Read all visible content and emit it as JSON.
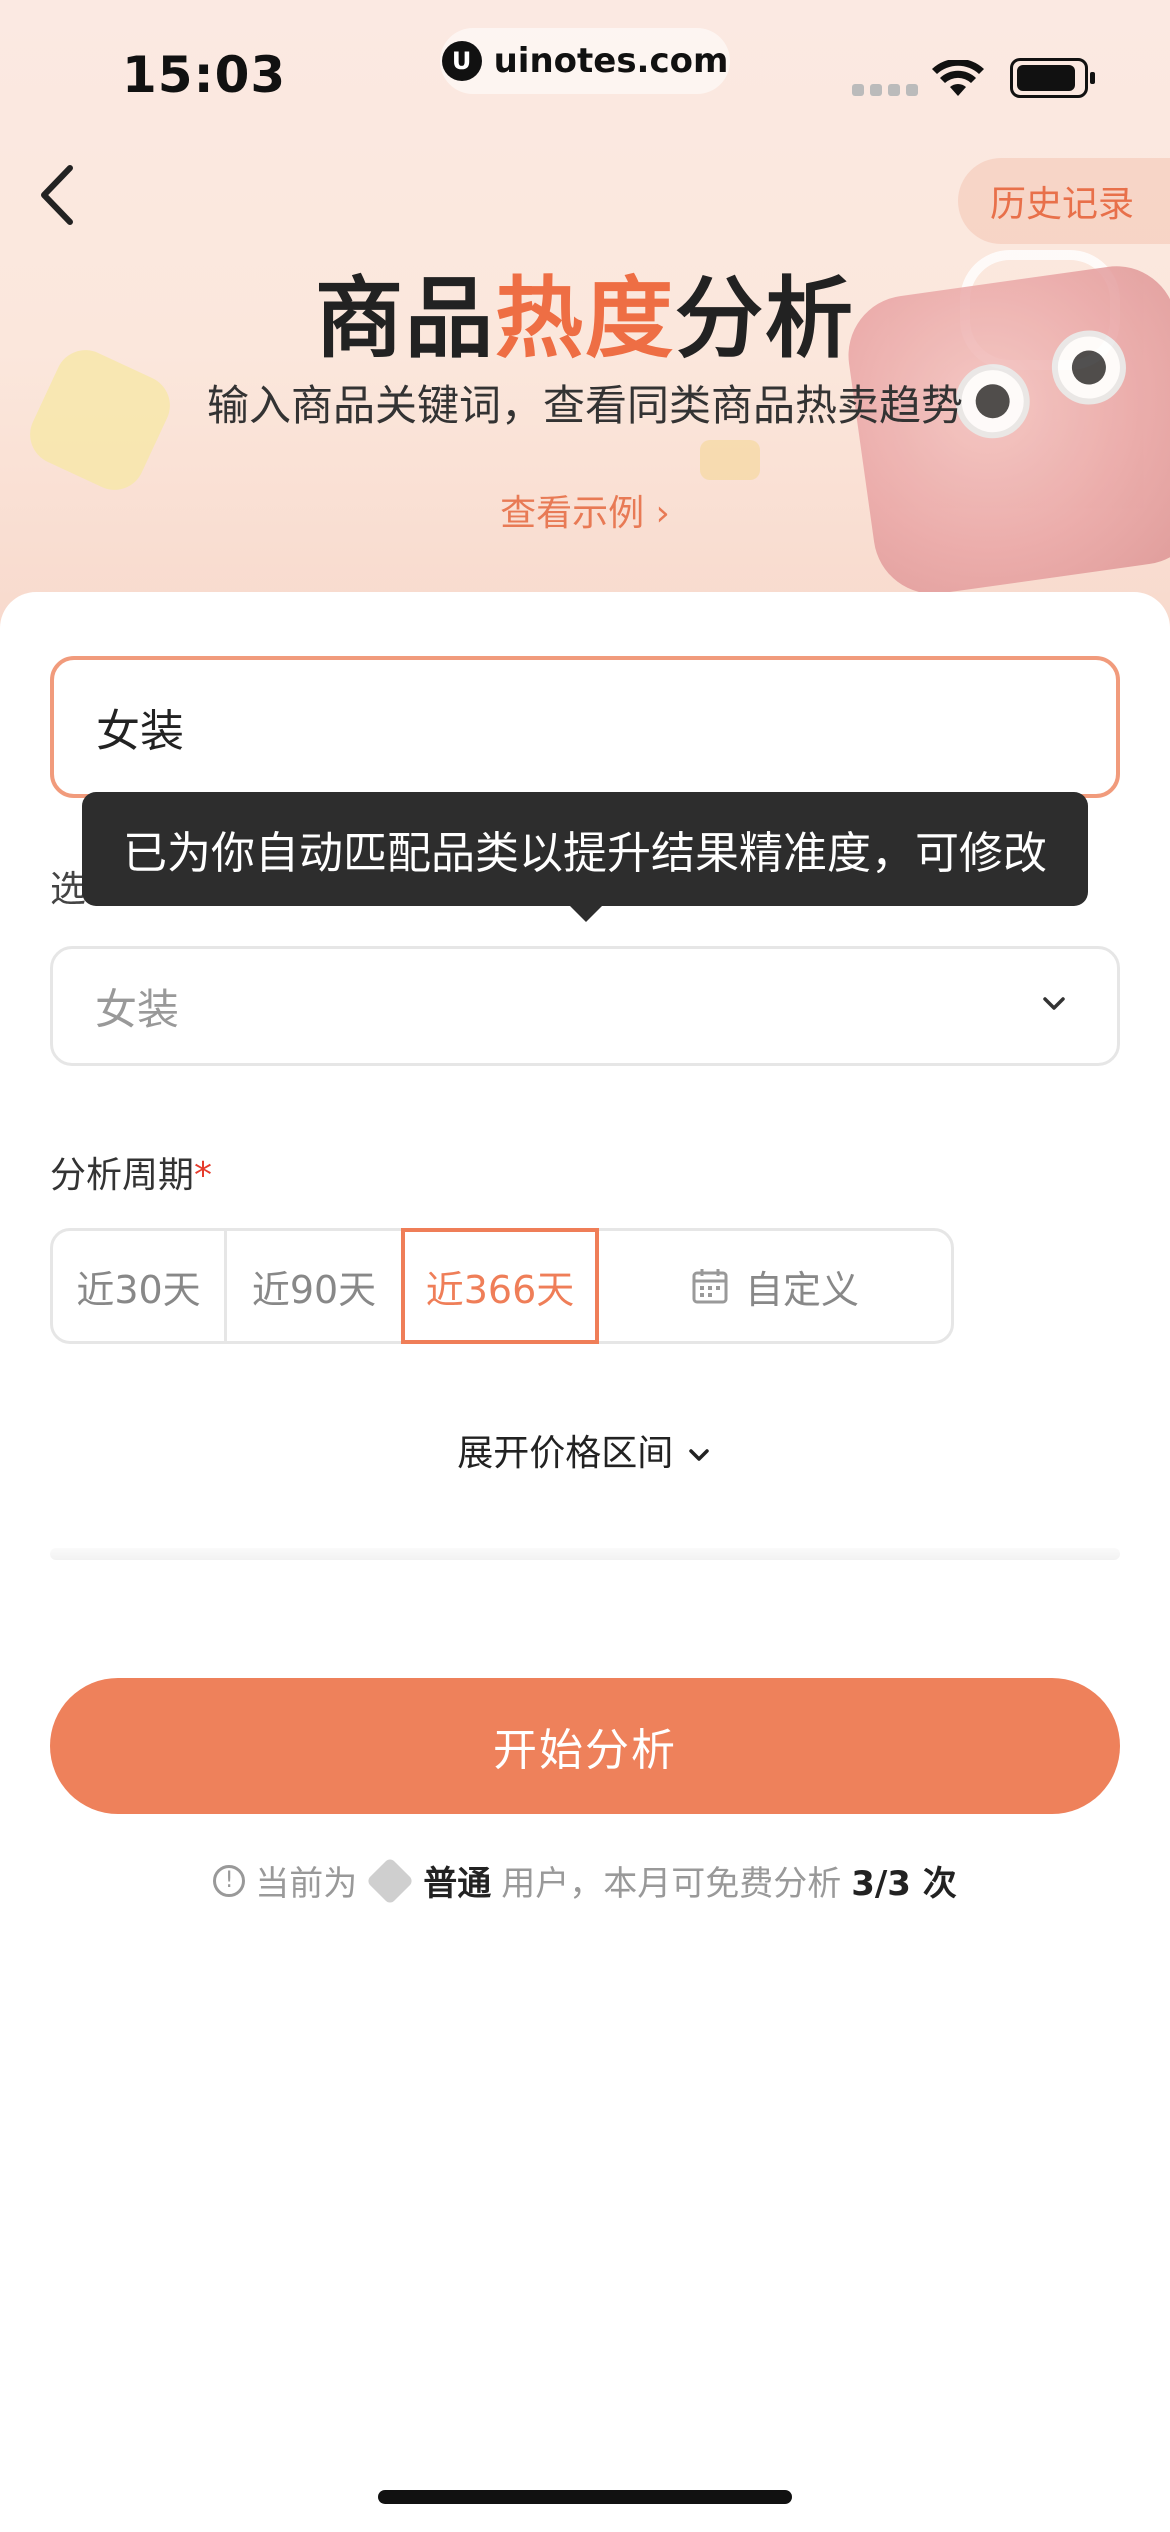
{
  "status_bar": {
    "time": "15:03",
    "url": "uinotes.com"
  },
  "header": {
    "history_label": "历史记录",
    "title_part1": "商品",
    "title_highlight": "热度",
    "title_part2": "分析",
    "subtitle": "输入商品关键词，查看同类商品热卖趋势",
    "example_link": "查看示例 ›"
  },
  "form": {
    "keyword_value": "女装",
    "category_label": "选",
    "tooltip": "已为你自动匹配品类以提升结果精准度，可修改",
    "category_value": "女装",
    "period_label": "分析周期",
    "period_required": "*",
    "period_options": [
      "近30天",
      "近90天",
      "近366天",
      "自定义"
    ],
    "period_selected": "近366天",
    "expand_price": "展开价格区间"
  },
  "action": {
    "start_label": "开始分析"
  },
  "quota": {
    "prefix": "当前为",
    "tier": "普通",
    "middle": "用户，本月可免费分析",
    "count": "3/3 次"
  },
  "colors": {
    "accent": "#ee815b",
    "highlight": "#ee6e44",
    "tooltip_bg": "#2d2d2d"
  },
  "icons": [
    "back-chevron-icon",
    "wifi-icon",
    "battery-icon",
    "chevron-down-icon",
    "calendar-icon",
    "info-icon",
    "gem-icon"
  ]
}
